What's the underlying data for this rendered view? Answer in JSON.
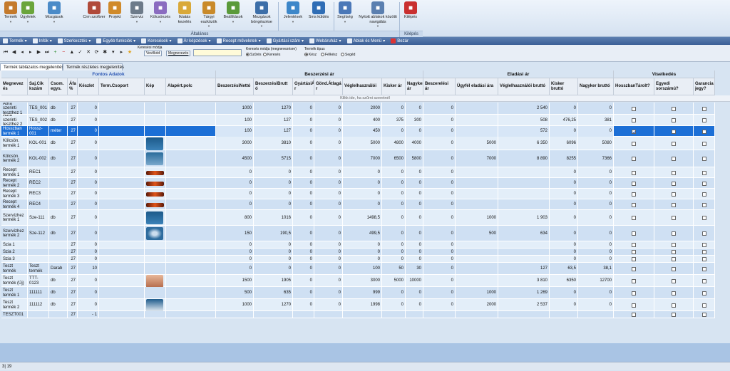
{
  "ribbon": {
    "buttons": [
      {
        "label": "Termék",
        "icon": "product-icon",
        "color": "#c47a2c",
        "dd": true
      },
      {
        "label": "Ügyfelek",
        "icon": "customers-icon",
        "color": "#6aa53b",
        "dd": true
      },
      {
        "label": "Mozgások",
        "icon": "movements-icon",
        "color": "#4b8bc8",
        "dd": true
      },
      {
        "label": "Crm szoftver",
        "icon": "crm-icon",
        "color": "#b04a3a",
        "dd": false
      },
      {
        "label": "Projekt",
        "icon": "project-icon",
        "color": "#d08a2a",
        "dd": false
      },
      {
        "label": "Szerviz",
        "icon": "service-icon",
        "color": "#6d7b8a",
        "dd": true
      },
      {
        "label": "Kölcsönzés",
        "icon": "rental-icon",
        "color": "#8a6cc0",
        "dd": true
      },
      {
        "label": "Iktatás kezelés",
        "icon": "filing-icon",
        "color": "#d9a93a",
        "dd": false
      },
      {
        "label": "Tárgyi eszközök",
        "icon": "assets-icon",
        "color": "#c98a2a",
        "dd": true
      },
      {
        "label": "Beállítások",
        "icon": "settings-icon",
        "color": "#5a9a3a",
        "dd": true
      },
      {
        "label": "Mozgások böngészése",
        "icon": "browse-icon",
        "color": "#3c6ea8",
        "dd": true
      },
      {
        "label": "Jelentések",
        "icon": "reports-icon",
        "color": "#3d87c9",
        "dd": true
      },
      {
        "label": "Sms küldés",
        "icon": "sms-icon",
        "color": "#2f6db5",
        "dd": false
      },
      {
        "label": "Segítség",
        "icon": "help-icon",
        "color": "#4b78b8",
        "dd": true
      },
      {
        "label": "Nyitott ablakok közötti navigálás",
        "icon": "windows-icon",
        "color": "#5a7fb0",
        "dd": true
      },
      {
        "label": "Kilépés",
        "icon": "exit-icon",
        "color": "#c93030",
        "dd": false
      }
    ],
    "groups": {
      "main": "Általános",
      "exit": "Kilépés"
    }
  },
  "menubar": [
    {
      "label": "Termék",
      "icon": "product-icon"
    },
    {
      "label": "Infók",
      "icon": "info-icon"
    },
    {
      "label": "Szerkesztés",
      "icon": "edit-icon"
    },
    {
      "label": "Egyéb funkciók",
      "icon": "functions-icon"
    },
    {
      "label": "Keresések",
      "icon": "search-icon"
    },
    {
      "label": "Ár képzések",
      "icon": "price-icon"
    },
    {
      "label": "Recept műveletek",
      "icon": "recipe-icon"
    },
    {
      "label": "Gyártási szám",
      "icon": "serial-icon"
    },
    {
      "label": "Webáruház",
      "icon": "webshop-icon"
    },
    {
      "label": "Ablak és Menü",
      "icon": "window-icon"
    },
    {
      "label": "Bezár",
      "icon": "close-icon"
    }
  ],
  "navbar": {
    "search_mode_title": "Keresési módja",
    "btn_vevokod": "Vevőkód",
    "btn_megnevezes": "Megnevezés",
    "search_mode2_title": "Keresés módja (megnevezésre)",
    "opt_szures": "Szűrés",
    "opt_kereses": "Keresés",
    "termek_tipus_title": "Termék típus",
    "opt_kesz": "Kész",
    "opt_felkesz": "Félkész",
    "opt_seged": "Segéd"
  },
  "tabs": [
    "Termék táblázatos megjelenítés",
    "Termék részletes megjelenítés"
  ],
  "groups": {
    "fontos": "Fontos Adatok",
    "beszerzesi": "Beszerzési ár",
    "eladasi": "Eladási ár",
    "viselkedes": "Viselkedés"
  },
  "columns": [
    "Megnevez és",
    "Saj.Cik kszám",
    "Csom. egys.",
    "Áfa %",
    "Készlet",
    "Term.Csoport",
    "Kép",
    "Alapért.polc",
    "BeszerzésiNettó",
    "BeszerzésiBrutt ó",
    "GyártásiÁ r",
    "Gönd.Átlagá r",
    "Véglelhasználói",
    "Kisker ár",
    "Nagyker ár",
    "Beszerelési ár",
    "Ügyfél eladási ára",
    "Véglelhasználói bruttó",
    "Kisker bruttó",
    "Nagyker bruttó",
    "HosszbanTárolt?",
    "Egyedi sorszámú?",
    "Garancia jegy?"
  ],
  "filter_hint": "Klikk ide, ha szűrni szeretnél",
  "rows": [
    {
      "name": "Ábra szerinti teszthez 1",
      "sku": "TES_001",
      "unit": "db",
      "vat": "27",
      "stock": "0",
      "img": "",
      "bnet": "1000",
      "bgross": "1270",
      "prod": "0",
      "avg": "0",
      "end": "2000",
      "retail": "0",
      "whole": "0",
      "inst": "0",
      "cust": "",
      "endg": "2 540",
      "retg": "0",
      "whg": "0",
      "long": false
    },
    {
      "name": "Ábra szerinti teszthez 2",
      "sku": "TES_002",
      "unit": "db",
      "vat": "27",
      "stock": "0",
      "img": "",
      "bnet": "100",
      "bgross": "127",
      "prod": "0",
      "avg": "0",
      "end": "400",
      "retail": "375",
      "whole": "300",
      "inst": "0",
      "cust": "",
      "endg": "508",
      "retg": "476,25",
      "whg": "381",
      "long": false
    },
    {
      "name": "Hosszban termék 1",
      "sku": "Hossz-001",
      "unit": "méter",
      "vat": "27",
      "stock": "0",
      "img": "",
      "bnet": "100",
      "bgross": "127",
      "prod": "0",
      "avg": "0",
      "end": "450",
      "retail": "0",
      "whole": "0",
      "inst": "0",
      "cust": "",
      "endg": "572",
      "retg": "0",
      "whg": "0",
      "long": true,
      "selected": true
    },
    {
      "name": "Kölcsön. termék 1",
      "sku": "KOL-001",
      "unit": "db",
      "vat": "27",
      "stock": "0",
      "img": "tool",
      "bnet": "3000",
      "bgross": "3810",
      "prod": "0",
      "avg": "0",
      "end": "5000",
      "retail": "4800",
      "whole": "4000",
      "inst": "0",
      "cust": "5000",
      "endg": "6 350",
      "retg": "6096",
      "whg": "5080",
      "long": false
    },
    {
      "name": "Kölcsön. termék 2",
      "sku": "KOL-002",
      "unit": "db",
      "vat": "27",
      "stock": "0",
      "img": "drill",
      "bnet": "4500",
      "bgross": "5715",
      "prod": "0",
      "avg": "0",
      "end": "7000",
      "retail": "6500",
      "whole": "5800",
      "inst": "0",
      "cust": "7000",
      "endg": "8 890",
      "retg": "8255",
      "whg": "7366",
      "long": false
    },
    {
      "name": "Recept termék 1",
      "sku": "REC1",
      "unit": "",
      "vat": "27",
      "stock": "0",
      "img": "led",
      "bnet": "0",
      "bgross": "0",
      "prod": "0",
      "avg": "0",
      "end": "0",
      "retail": "0",
      "whole": "0",
      "inst": "0",
      "cust": "",
      "endg": "",
      "retg": "0",
      "whg": "0",
      "long": false
    },
    {
      "name": "Recept termék 2",
      "sku": "REC2",
      "unit": "",
      "vat": "27",
      "stock": "0",
      "img": "led",
      "bnet": "0",
      "bgross": "0",
      "prod": "0",
      "avg": "0",
      "end": "0",
      "retail": "0",
      "whole": "0",
      "inst": "0",
      "cust": "",
      "endg": "",
      "retg": "0",
      "whg": "0",
      "long": false
    },
    {
      "name": "Recept termék 3",
      "sku": "REC3",
      "unit": "",
      "vat": "27",
      "stock": "0",
      "img": "led",
      "bnet": "0",
      "bgross": "0",
      "prod": "0",
      "avg": "0",
      "end": "0",
      "retail": "0",
      "whole": "0",
      "inst": "0",
      "cust": "",
      "endg": "",
      "retg": "0",
      "whg": "0",
      "long": false
    },
    {
      "name": "Recept termék 4",
      "sku": "REC4",
      "unit": "",
      "vat": "27",
      "stock": "0",
      "img": "led",
      "bnet": "0",
      "bgross": "0",
      "prod": "0",
      "avg": "0",
      "end": "0",
      "retail": "0",
      "whole": "0",
      "inst": "0",
      "cust": "",
      "endg": "",
      "retg": "0",
      "whg": "0",
      "long": false
    },
    {
      "name": "Szervízhez termék 1",
      "sku": "Sze-111",
      "unit": "db",
      "vat": "27",
      "stock": "0",
      "img": "tool",
      "bnet": "800",
      "bgross": "1016",
      "prod": "0",
      "avg": "0",
      "end": "1498,5",
      "retail": "0",
      "whole": "0",
      "inst": "0",
      "cust": "1000",
      "endg": "1 903",
      "retg": "0",
      "whg": "0",
      "long": false
    },
    {
      "name": "Szervízhez termék 2",
      "sku": "Sze-112",
      "unit": "db",
      "vat": "27",
      "stock": "0",
      "img": "disc",
      "bnet": "150",
      "bgross": "190,5",
      "prod": "0",
      "avg": "0",
      "end": "499,5",
      "retail": "0",
      "whole": "0",
      "inst": "0",
      "cust": "500",
      "endg": "634",
      "retg": "0",
      "whg": "0",
      "long": false
    },
    {
      "name": "Szia 1",
      "sku": "",
      "unit": "",
      "vat": "27",
      "stock": "0",
      "img": "",
      "bnet": "0",
      "bgross": "0",
      "prod": "0",
      "avg": "0",
      "end": "0",
      "retail": "0",
      "whole": "0",
      "inst": "0",
      "cust": "",
      "endg": "",
      "retg": "0",
      "whg": "0",
      "long": false
    },
    {
      "name": "Szia 2",
      "sku": "",
      "unit": "",
      "vat": "27",
      "stock": "0",
      "img": "",
      "bnet": "0",
      "bgross": "0",
      "prod": "0",
      "avg": "0",
      "end": "0",
      "retail": "0",
      "whole": "0",
      "inst": "0",
      "cust": "",
      "endg": "",
      "retg": "0",
      "whg": "0",
      "long": false
    },
    {
      "name": "Szia 3",
      "sku": "",
      "unit": "",
      "vat": "27",
      "stock": "0",
      "img": "",
      "bnet": "0",
      "bgross": "0",
      "prod": "0",
      "avg": "0",
      "end": "0",
      "retail": "0",
      "whole": "0",
      "inst": "0",
      "cust": "",
      "endg": "",
      "retg": "0",
      "whg": "0",
      "long": false
    },
    {
      "name": "Teszt termék",
      "sku": "Teszt termék",
      "unit": "Darab",
      "vat": "27",
      "stock": "10",
      "img": "",
      "bnet": "0",
      "bgross": "0",
      "prod": "0",
      "avg": "0",
      "end": "100",
      "retail": "50",
      "whole": "30",
      "inst": "0",
      "cust": "",
      "endg": "127",
      "retg": "63,5",
      "whg": "38,1",
      "long": false
    },
    {
      "name": "Teszt termék (Új)",
      "sku": "TTT-0123",
      "unit": "db",
      "vat": "27",
      "stock": "0",
      "img": "box",
      "bnet": "1500",
      "bgross": "1905",
      "prod": "0",
      "avg": "0",
      "end": "3000",
      "retail": "5000",
      "whole": "10000",
      "inst": "0",
      "cust": "",
      "endg": "3 810",
      "retg": "6350",
      "whg": "12700",
      "long": false
    },
    {
      "name": "Teszt termék 1",
      "sku": "111111",
      "unit": "db",
      "vat": "27",
      "stock": "0",
      "img": "",
      "bnet": "500",
      "bgross": "635",
      "prod": "0",
      "avg": "0",
      "end": "999",
      "retail": "0",
      "whole": "0",
      "inst": "0",
      "cust": "1000",
      "endg": "1 269",
      "retg": "0",
      "whg": "0",
      "long": false
    },
    {
      "name": "Teszt termék 2",
      "sku": "111112",
      "unit": "db",
      "vat": "27",
      "stock": "0",
      "img": "blade",
      "bnet": "1000",
      "bgross": "1270",
      "prod": "0",
      "avg": "0",
      "end": "1998",
      "retail": "0",
      "whole": "0",
      "inst": "0",
      "cust": "2000",
      "endg": "2 537",
      "retg": "0",
      "whg": "0",
      "long": false
    },
    {
      "name": "TESZT001",
      "sku": "",
      "unit": "",
      "vat": "27",
      "stock": "- 1",
      "img": "",
      "bnet": "",
      "bgross": "",
      "prod": "",
      "avg": "",
      "end": "",
      "retail": "",
      "whole": "",
      "inst": "",
      "cust": "",
      "endg": "",
      "retg": "",
      "whg": "",
      "long": false
    }
  ],
  "status": "3| 19",
  "colors": {
    "selected": "#1c6fd6",
    "rowA": "#cfe0f3",
    "rowB": "#e3eef9",
    "accent": "#3b5f96"
  }
}
